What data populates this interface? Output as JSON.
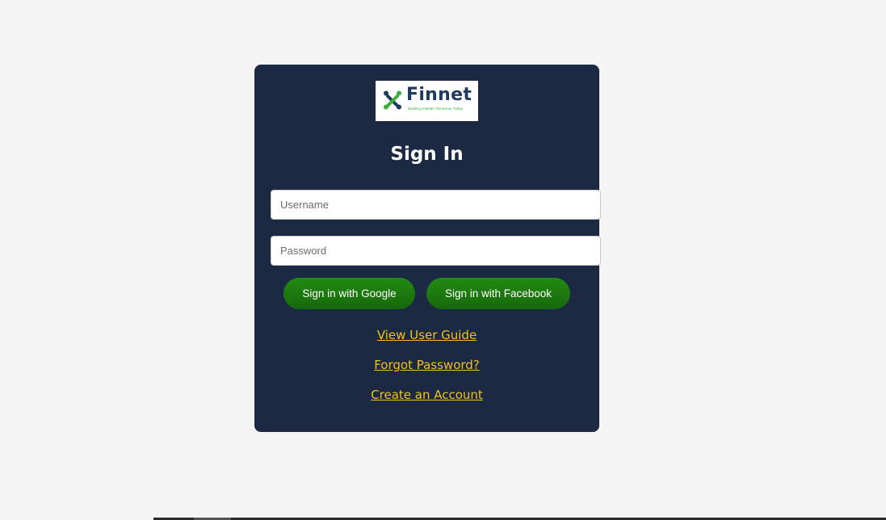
{
  "brand": {
    "name": "Finnet",
    "tagline": "Building a Better Tomorrow, Today",
    "mark_icon": "finnet-x-logo-icon",
    "colors": {
      "navy": "#1e3a5f",
      "green": "#3cae3c"
    }
  },
  "form": {
    "title": "Sign In",
    "username_placeholder": "Username",
    "username_value": "",
    "password_placeholder": "Password",
    "password_value": ""
  },
  "buttons": {
    "google_label": "Sign in with Google",
    "facebook_label": "Sign in with Facebook"
  },
  "links": {
    "user_guide": "View User Guide",
    "forgot_password": "Forgot Password?",
    "create_account": "Create an Account"
  },
  "colors": {
    "page_bg": "#f4f4f4",
    "card_bg": "#1b2942",
    "button_green": "#1f7f10",
    "link_yellow": "#f3c11a"
  }
}
